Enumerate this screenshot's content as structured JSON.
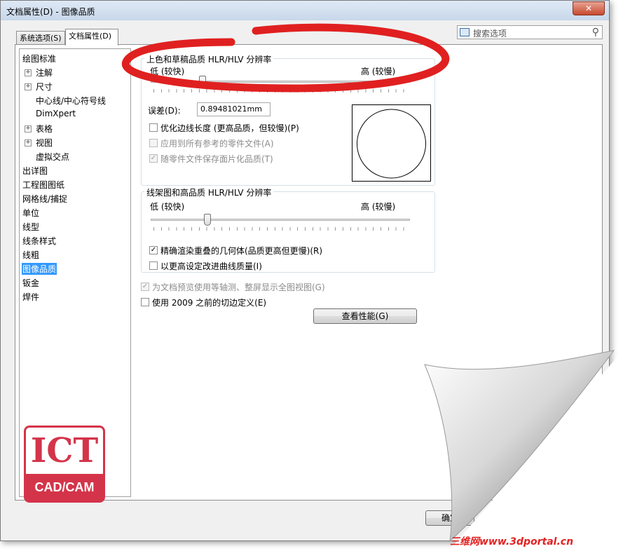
{
  "window": {
    "title": "文档属性(D) - 图像品质",
    "close_label": "✕"
  },
  "tabs": [
    {
      "label": "系统选项(S)"
    },
    {
      "label": "文档属性(D)"
    }
  ],
  "search": {
    "placeholder": "搜索选项"
  },
  "tree": {
    "items": [
      {
        "label": "绘图标准"
      },
      {
        "label": "注解"
      },
      {
        "label": "尺寸"
      },
      {
        "label": "中心线/中心符号线"
      },
      {
        "label": "DimXpert"
      },
      {
        "label": "表格"
      },
      {
        "label": "视图"
      },
      {
        "label": "虚拟交点"
      },
      {
        "label": "出详图"
      },
      {
        "label": "工程图图纸"
      },
      {
        "label": "网格线/捕捉"
      },
      {
        "label": "单位"
      },
      {
        "label": "线型"
      },
      {
        "label": "线条样式"
      },
      {
        "label": "线粗"
      },
      {
        "label": "图像品质"
      },
      {
        "label": "钣金"
      },
      {
        "label": "焊件"
      }
    ],
    "selected": "图像品质"
  },
  "shaded_group": {
    "title": "上色和草稿品质 HLR/HLV 分辨率",
    "low_label": "低 (较快)",
    "high_label": "高 (较慢)",
    "slider_fraction": 0.2,
    "deviation_label": "误差(D):",
    "deviation_value": "0.89481021mm",
    "opt_optimize": "优化边线长度 (更高品质，但较慢)(P)",
    "opt_apply_all": "应用到所有参考的零件文件(A)",
    "opt_save_tess": "随零件文件保存面片化品质(T)"
  },
  "wireframe_group": {
    "title": "线架图和高品质 HLR/HLV 分辨率",
    "low_label": "低 (较快)",
    "high_label": "高 (较慢)",
    "slider_fraction": 0.22,
    "opt_precise": "精确渲染重叠的几何体(品质更高但更慢)(R)",
    "opt_higher_curve": "以更高设定改进曲线质量(I)"
  },
  "options": {
    "iso_preview": "为文档预览使用等轴测、整屏显示全图视图(G)",
    "pre2009": "使用 2009 之前的切边定义(E)",
    "perf_button": "查看性能(G)",
    "ok_button": "确定"
  },
  "logo": {
    "top": "ICT",
    "bottom": "CAD/CAM"
  },
  "watermark": "三维网www.3dportal.cn",
  "colors": {
    "annotation_red": "#e02020",
    "selection_blue": "#3399ff",
    "logo_red": "#d4344a"
  }
}
